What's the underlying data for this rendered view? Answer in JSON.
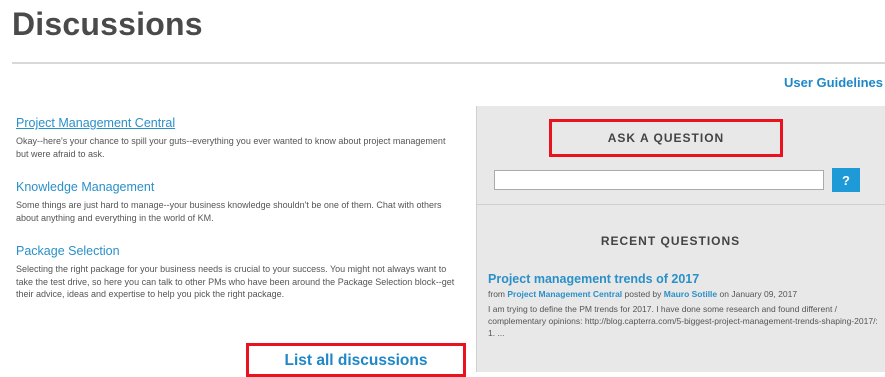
{
  "header": {
    "title": "Discussions",
    "user_guidelines": "User Guidelines"
  },
  "forums": [
    {
      "title": "Project Management Central",
      "description": "Okay--here's your chance to spill your guts--everything you ever wanted to know about project management but were afraid to ask."
    },
    {
      "title": "Knowledge Management",
      "description": "Some things are just hard to manage--your business knowledge shouldn't be one of them. Chat with others about anything and everything in the world of KM."
    },
    {
      "title": "Package Selection",
      "description": "Selecting the right package for your business needs is crucial to your success. You might not always want to take the test drive, so here you can talk to other PMs who have been around the Package Selection block--get their advice, ideas and expertise to help you pick the right package."
    }
  ],
  "list_all_label": "List all discussions",
  "sidebar": {
    "ask_label": "ASK A QUESTION",
    "ask_button_label": "?",
    "search_placeholder": "",
    "recent_heading": "RECENT QUESTIONS",
    "question": {
      "title": "Project management trends of 2017",
      "from_prefix": "from",
      "forum": "Project Management Central",
      "posted_by_prefix": "posted by",
      "author": "Mauro Sotille",
      "date_prefix": "on",
      "date": "January 09, 2017",
      "excerpt": "I am trying to define the PM trends for 2017. I have done some research and found different / complementary opinions: http://blog.capterra.com/5-biggest-project-management-trends-shaping-2017/: 1. ..."
    }
  },
  "colors": {
    "link": "#2a90c8",
    "highlight": "#e8131e",
    "button": "#1e9ad6",
    "sidebar_bg": "#e8e8e8"
  }
}
